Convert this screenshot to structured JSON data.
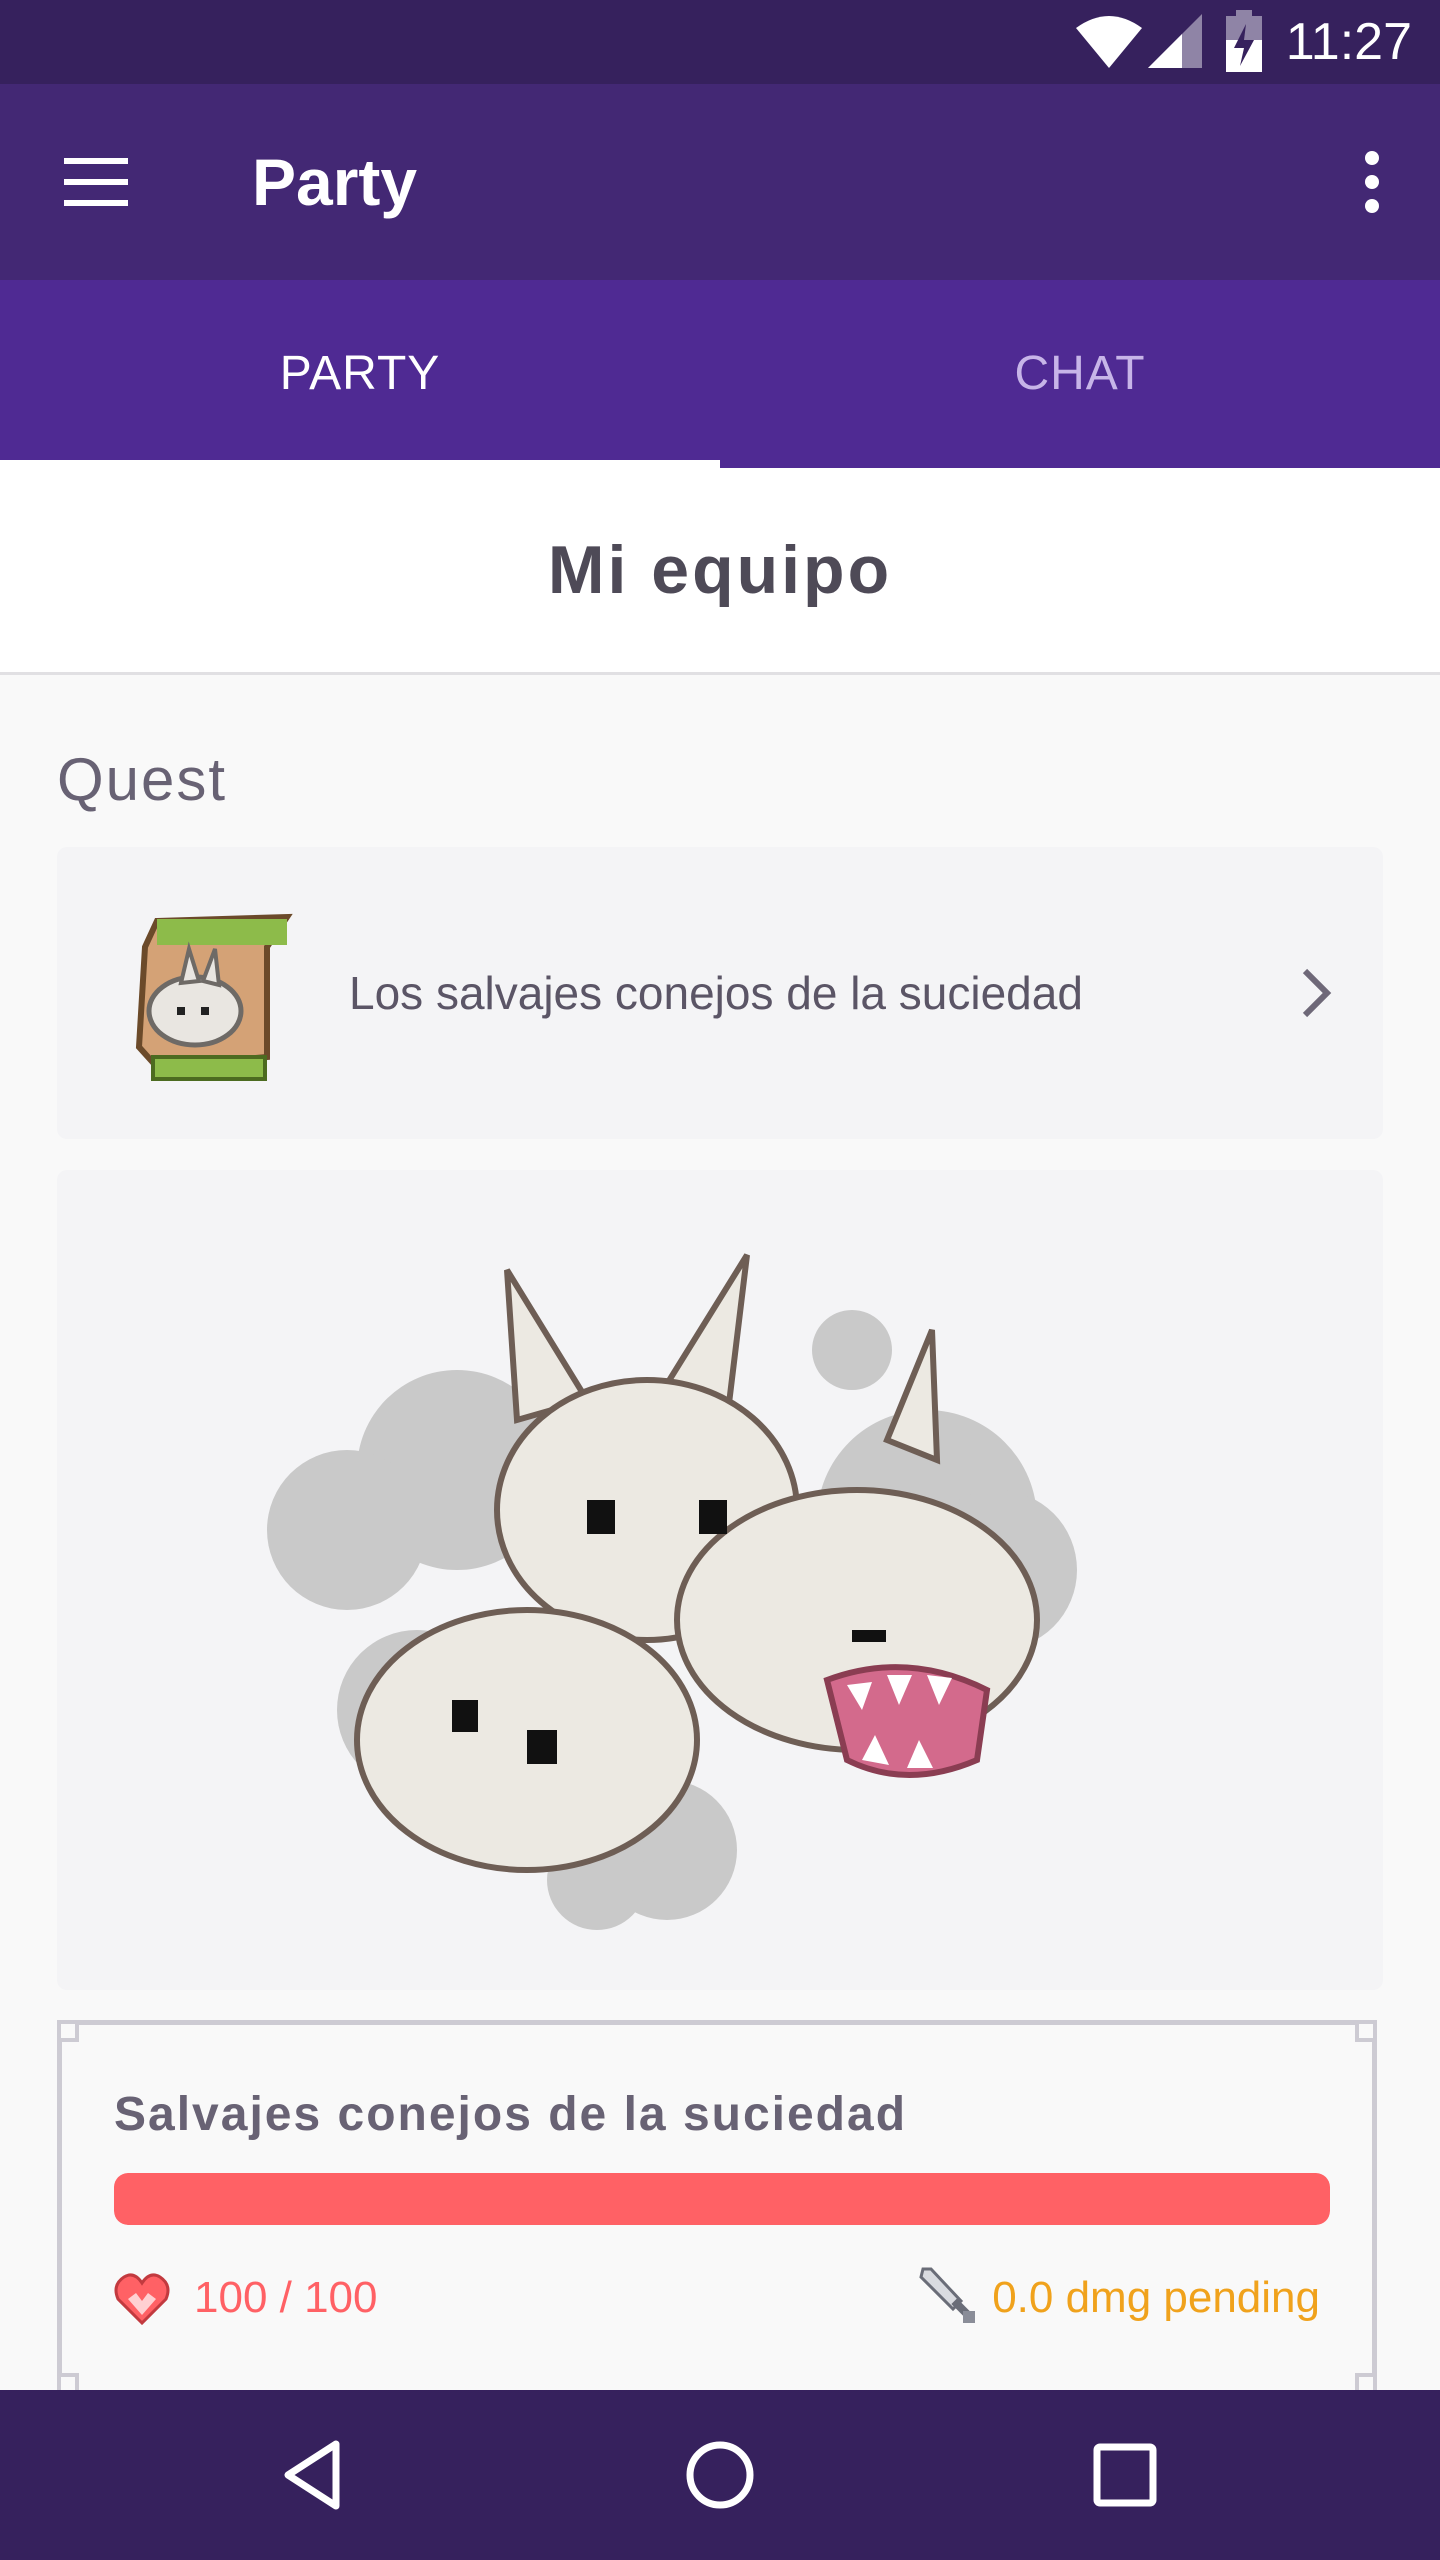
{
  "status_bar": {
    "time": "11:27",
    "icons": [
      "wifi-icon",
      "signal-icon",
      "battery-icon"
    ]
  },
  "app_bar": {
    "title": "Party",
    "menu_icon": "hamburger-menu-icon",
    "more_icon": "more-vert-icon"
  },
  "tabs": [
    {
      "label": "PARTY",
      "active": true
    },
    {
      "label": "CHAT",
      "active": false
    }
  ],
  "party": {
    "name": "Mi equipo"
  },
  "quest": {
    "section_label": "Quest",
    "title": "Los salvajes conejos de la suciedad",
    "boss": {
      "name": "Salvajes conejos de la suciedad",
      "hp_text": "100 / 100",
      "hp_current": 100,
      "hp_max": 100,
      "damage_pending_text": "0.0 dmg pending"
    }
  },
  "colors": {
    "status_bar": "#36215d",
    "app_bar": "#432874",
    "tab_bar": "#4f2a93",
    "hp_red": "#ff6165",
    "damage_yellow": "#f0a21c",
    "nav_bar": "#36215d"
  },
  "nav_bar": {
    "icons": [
      "back-icon",
      "home-icon",
      "recents-icon"
    ]
  }
}
